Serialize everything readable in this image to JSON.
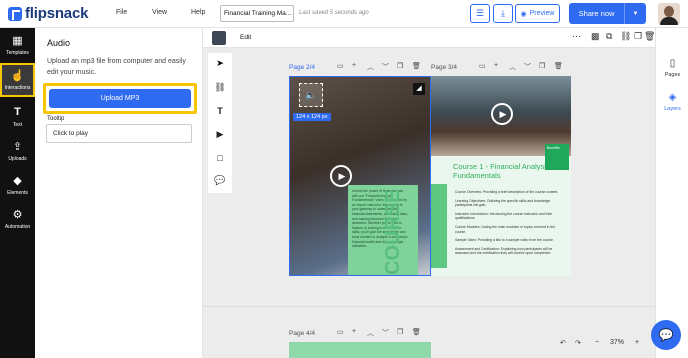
{
  "header": {
    "logo_text": "flipsnack",
    "menu": [
      "File",
      "View",
      "Help"
    ],
    "doc_title": "Financial Training Ma...",
    "saved_text": "Last saved 5 seconds ago",
    "preview_label": "Preview",
    "share_label": "Share now",
    "accent": "#2f6bf0"
  },
  "left_nav": {
    "items": [
      {
        "label": "Templates",
        "icon": "grid-icon"
      },
      {
        "label": "Interactions",
        "icon": "pointer-icon",
        "active": true
      },
      {
        "label": "Text",
        "icon": "text-icon"
      },
      {
        "label": "Uploads",
        "icon": "upload-icon"
      },
      {
        "label": "Elements",
        "icon": "shapes-icon"
      },
      {
        "label": "Automation",
        "icon": "robot-icon"
      }
    ]
  },
  "panel": {
    "title": "Audio",
    "description": "Upload an mp3 file from computer and easily edit your music.",
    "upload_label": "Upload MP3",
    "tooltip_label": "Tooltip",
    "tooltip_value": "Click to play",
    "highlight": "#f7c600"
  },
  "canvas": {
    "edit_label": "Edit",
    "page_2_4": "Page 2/4",
    "page_3_4": "Page 3/4",
    "page_4_4": "Page 4/4",
    "size_tag": "124 x 124 px",
    "course_title": "Course 1 - Financial Analysis Fundamentals",
    "benefits": "Benefits",
    "vertical_text": "COURSE",
    "left_body": "Unlock the power of financial data with our \"Financial Analysis Fundamentals\" video course. Led by an expert instructor, this course is your gateway to understanding financial statements, assessing risks, and making informed financial decisions. Whether you're new to finance or looking to refresh your skills, you'll gain the knowledge and tools needed to analyze a company's financial health and drive strategic initiatives.",
    "course_items": [
      "Course Overview: Providing a brief description of the course content.",
      "Learning Objectives: Outlining the specific skills and knowledge participants will gain.",
      "Instructor Introduction: Introducing the course instructor and their qualifications.",
      "Course Modules: Listing the main modules or topics covered in the course.",
      "Sample Video: Providing a link to a sample video from the course.",
      "Assessment and Certification: Explaining how participants will be assessed and the certification they will receive upon completion."
    ],
    "zoom": "37%"
  },
  "right_nav": {
    "items": [
      {
        "label": "Pages",
        "icon": "pages-icon"
      },
      {
        "label": "Layers",
        "icon": "layers-icon",
        "active": true
      }
    ]
  }
}
